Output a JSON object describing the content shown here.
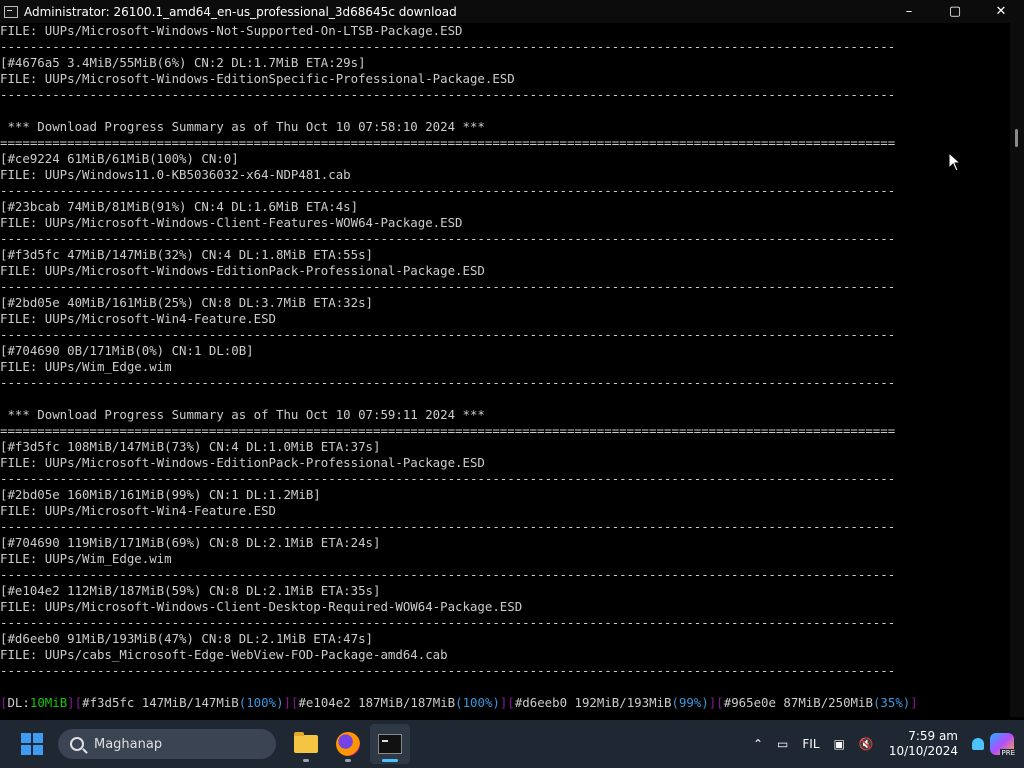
{
  "window": {
    "title": "Administrator:  26100.1_amd64_en-us_professional_3d68645c download",
    "controls": [
      "–",
      "▢",
      "✕"
    ]
  },
  "console": {
    "lines": [
      "FILE: UUPs/Microsoft-Windows-Not-Supported-On-LTSB-Package.ESD",
      "------------------------------------------------------------------------------------------------------------------------",
      "[#4676a5 3.4MiB/55MiB(6%) CN:2 DL:1.7MiB ETA:29s]",
      "FILE: UUPs/Microsoft-Windows-EditionSpecific-Professional-Package.ESD",
      "------------------------------------------------------------------------------------------------------------------------",
      "",
      " *** Download Progress Summary as of Thu Oct 10 07:58:10 2024 ***",
      "========================================================================================================================",
      "[#ce9224 61MiB/61MiB(100%) CN:0]",
      "FILE: UUPs/Windows11.0-KB5036032-x64-NDP481.cab",
      "------------------------------------------------------------------------------------------------------------------------",
      "[#23bcab 74MiB/81MiB(91%) CN:4 DL:1.6MiB ETA:4s]",
      "FILE: UUPs/Microsoft-Windows-Client-Features-WOW64-Package.ESD",
      "------------------------------------------------------------------------------------------------------------------------",
      "[#f3d5fc 47MiB/147MiB(32%) CN:4 DL:1.8MiB ETA:55s]",
      "FILE: UUPs/Microsoft-Windows-EditionPack-Professional-Package.ESD",
      "------------------------------------------------------------------------------------------------------------------------",
      "[#2bd05e 40MiB/161MiB(25%) CN:8 DL:3.7MiB ETA:32s]",
      "FILE: UUPs/Microsoft-Win4-Feature.ESD",
      "------------------------------------------------------------------------------------------------------------------------",
      "[#704690 0B/171MiB(0%) CN:1 DL:0B]",
      "FILE: UUPs/Wim_Edge.wim",
      "------------------------------------------------------------------------------------------------------------------------",
      "",
      " *** Download Progress Summary as of Thu Oct 10 07:59:11 2024 ***",
      "========================================================================================================================",
      "[#f3d5fc 108MiB/147MiB(73%) CN:4 DL:1.0MiB ETA:37s]",
      "FILE: UUPs/Microsoft-Windows-EditionPack-Professional-Package.ESD",
      "------------------------------------------------------------------------------------------------------------------------",
      "[#2bd05e 160MiB/161MiB(99%) CN:1 DL:1.2MiB]",
      "FILE: UUPs/Microsoft-Win4-Feature.ESD",
      "------------------------------------------------------------------------------------------------------------------------",
      "[#704690 119MiB/171MiB(69%) CN:8 DL:2.1MiB ETA:24s]",
      "FILE: UUPs/Wim_Edge.wim",
      "------------------------------------------------------------------------------------------------------------------------",
      "[#e104e2 112MiB/187MiB(59%) CN:8 DL:2.1MiB ETA:35s]",
      "FILE: UUPs/Microsoft-Windows-Client-Desktop-Required-WOW64-Package.ESD",
      "------------------------------------------------------------------------------------------------------------------------",
      "[#d6eeb0 91MiB/193MiB(47%) CN:8 DL:2.1MiB ETA:47s]",
      "FILE: UUPs/cabs_Microsoft-Edge-WebView-FOD-Package-amd64.cab",
      "------------------------------------------------------------------------------------------------------------------------",
      ""
    ],
    "status_segments": [
      {
        "text": "[",
        "color": "m"
      },
      {
        "text": "DL:",
        "color": ""
      },
      {
        "text": "10MiB",
        "color": "g"
      },
      {
        "text": "]",
        "color": "m"
      },
      {
        "text": "[",
        "color": "m"
      },
      {
        "text": "#f3d5fc 147MiB/147MiB",
        "color": ""
      },
      {
        "text": "(100%)",
        "color": "c"
      },
      {
        "text": "]",
        "color": "m"
      },
      {
        "text": "[",
        "color": "m"
      },
      {
        "text": "#e104e2 187MiB/187MiB",
        "color": ""
      },
      {
        "text": "(100%)",
        "color": "c"
      },
      {
        "text": "]",
        "color": "m"
      },
      {
        "text": "[",
        "color": "m"
      },
      {
        "text": "#d6eeb0 192MiB/193MiB",
        "color": ""
      },
      {
        "text": "(99%)",
        "color": "c"
      },
      {
        "text": "]",
        "color": "m"
      },
      {
        "text": "[",
        "color": "m"
      },
      {
        "text": "#965e0e 87MiB/250MiB",
        "color": ""
      },
      {
        "text": "(35%)",
        "color": "c"
      },
      {
        "text": "]",
        "color": "m"
      }
    ]
  },
  "taskbar": {
    "search_placeholder": "Maghanap",
    "language": "FIL",
    "time": "7:59 am",
    "date": "10/10/2024",
    "copilot_badge": "PRE"
  },
  "colors": {
    "accent": "#4cc2ff",
    "console_bg": "#000000",
    "console_text": "#cccccc"
  }
}
